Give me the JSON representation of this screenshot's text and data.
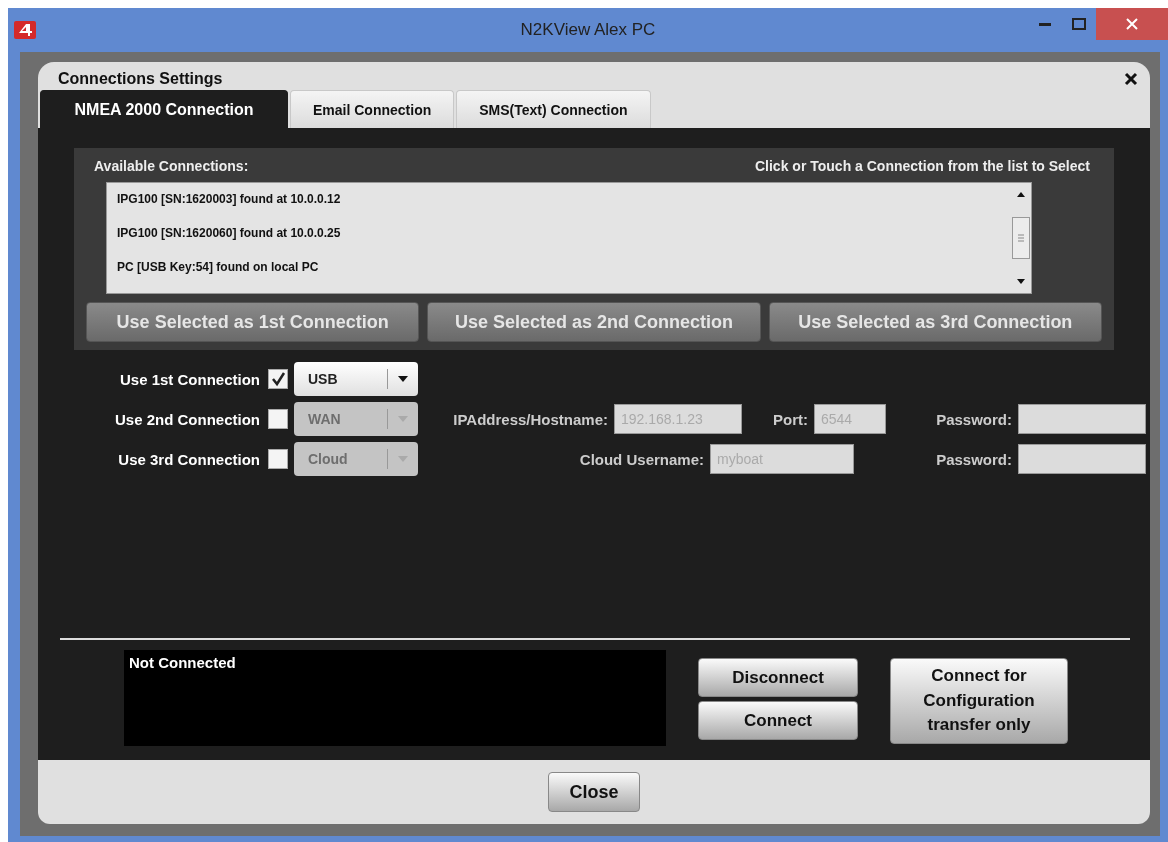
{
  "window": {
    "title": "N2KView Alex PC"
  },
  "dialog": {
    "title": "Connections Settings"
  },
  "tabs": [
    {
      "label": "NMEA 2000 Connection",
      "selected": true
    },
    {
      "label": "Email Connection",
      "selected": false
    },
    {
      "label": "SMS(Text) Connection",
      "selected": false
    }
  ],
  "available": {
    "label": "Available Connections:",
    "hint": "Click or Touch a Connection from the list to Select",
    "items": [
      {
        "text": "IPG100 [SN:1620003] found at 10.0.0.12",
        "selected": false
      },
      {
        "text": "IPG100 [SN:1620060] found at 10.0.0.25",
        "selected": false
      },
      {
        "text": "PC [USB Key:54] found on local PC",
        "selected": false
      }
    ]
  },
  "use_buttons": [
    {
      "label": "Use Selected as 1st Connection",
      "disabled": true
    },
    {
      "label": "Use Selected as 2nd Connection",
      "disabled": true
    },
    {
      "label": "Use Selected as 3rd Connection",
      "disabled": true
    }
  ],
  "connections": [
    {
      "label": "Use 1st Connection",
      "checked": true,
      "type": "USB",
      "type_disabled": false
    },
    {
      "label": "Use 2nd Connection",
      "checked": false,
      "type": "WAN",
      "type_disabled": true,
      "fields": [
        {
          "label": "IPAddress/Hostname:",
          "value": "192.168.1.23",
          "disabled": true
        },
        {
          "label": "Port:",
          "value": "6544",
          "disabled": true
        },
        {
          "label": "Password:",
          "disabled": true
        }
      ]
    },
    {
      "label": "Use 3rd Connection",
      "checked": false,
      "type": "Cloud",
      "type_disabled": true,
      "fields": [
        {
          "label": "Cloud Username:",
          "value": "myboat",
          "disabled": true
        },
        {
          "label": "Password:",
          "disabled": true
        }
      ]
    }
  ],
  "status": "Not Connected",
  "actions": [
    "Disconnect",
    "Connect"
  ],
  "config_button": "Connect for Configuration transfer only",
  "close_button": "Close"
}
